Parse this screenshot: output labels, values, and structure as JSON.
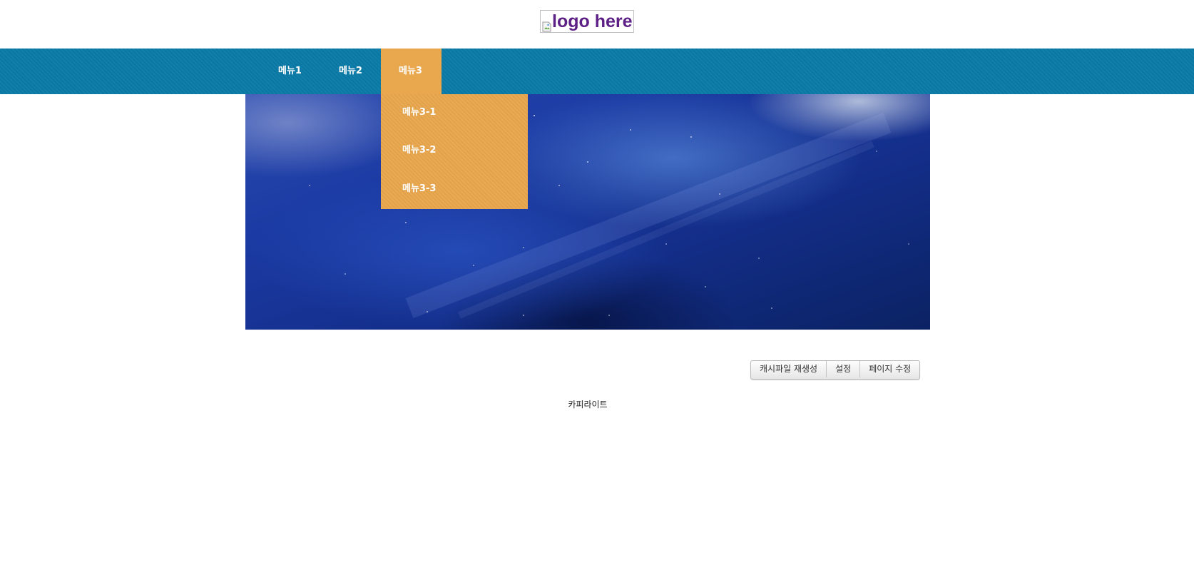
{
  "header": {
    "logo_alt": "logo here",
    "logo_icon": "broken-image-icon"
  },
  "nav": {
    "items": [
      {
        "label": "메뉴1"
      },
      {
        "label": "메뉴2"
      },
      {
        "label": "메뉴3",
        "active": true
      }
    ],
    "submenu": [
      {
        "label": "메뉴3-1"
      },
      {
        "label": "메뉴3-2"
      },
      {
        "label": "메뉴3-3"
      }
    ]
  },
  "toolbar": {
    "buttons": [
      {
        "label": "캐시파일 재생성"
      },
      {
        "label": "설정"
      },
      {
        "label": "페이지 수정"
      }
    ]
  },
  "footer": {
    "text": "카피라이트"
  },
  "colors": {
    "nav_bg": "#0a7aa7",
    "active_bg": "#e9a74e",
    "logo_text": "#5b1f86"
  }
}
